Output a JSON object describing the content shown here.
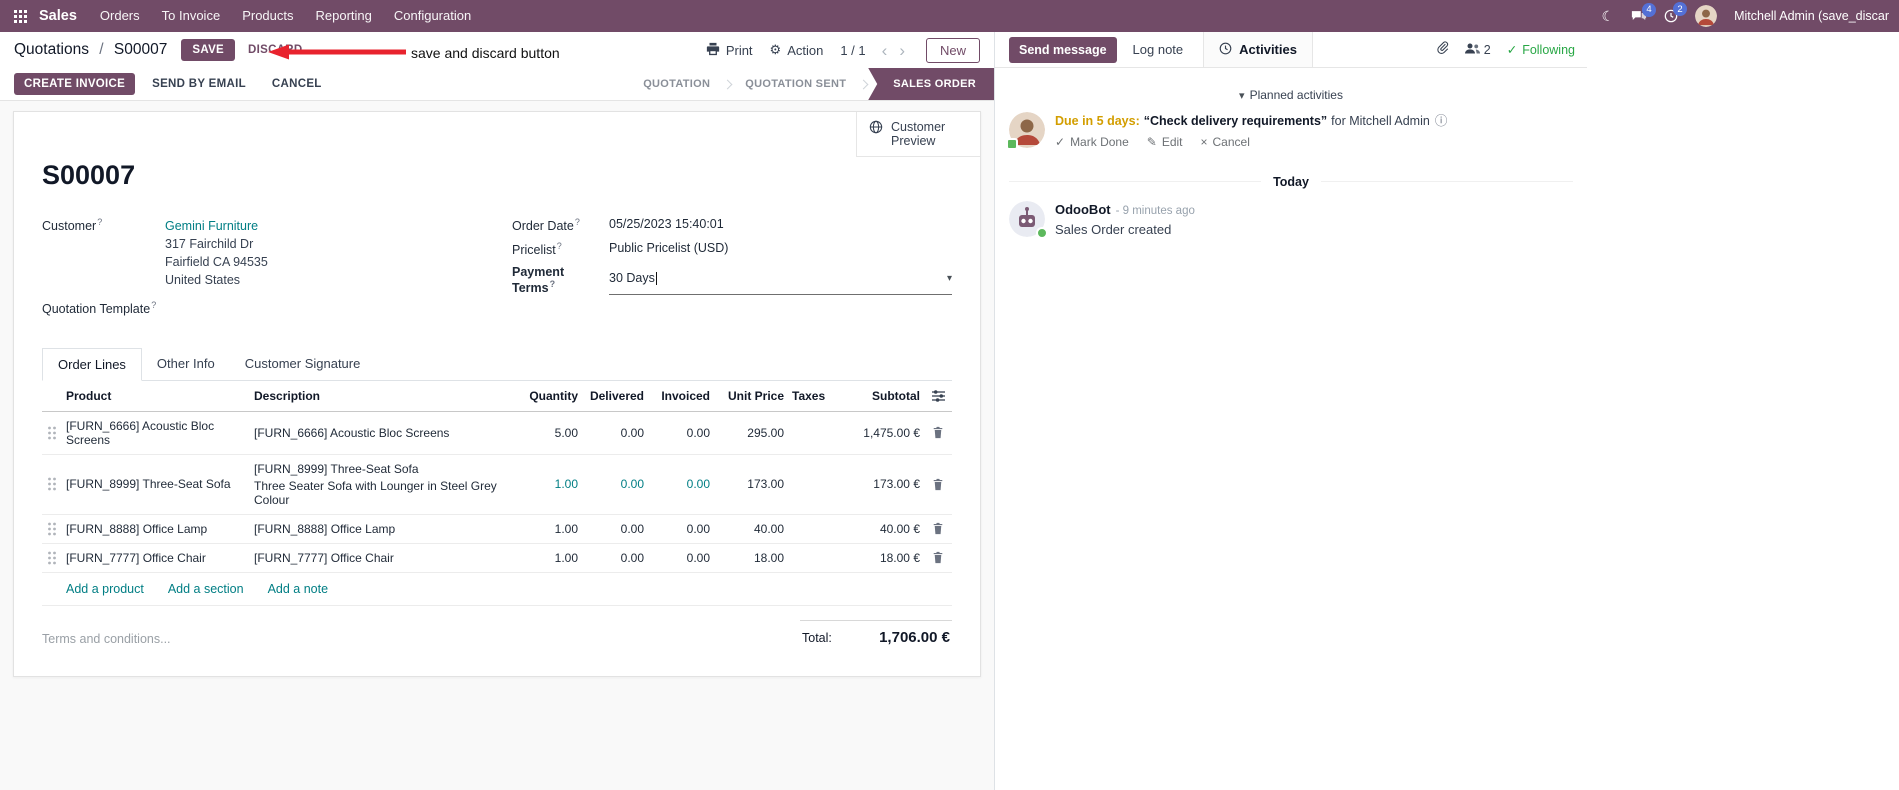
{
  "colors": {
    "brand": "#714B67",
    "link": "#017E84",
    "success": "#28a745",
    "warning": "#d39e00",
    "badge": "#5470d6",
    "annotation_red": "#e8232e"
  },
  "icons": {
    "caret_down": "▾",
    "gear": "⚙",
    "moon": "☾",
    "check": "✓",
    "pencil": "✎",
    "close": "×",
    "info": "ⓘ",
    "chev_left": "‹",
    "chev_right": "›",
    "help": "?",
    "slash": "/"
  },
  "topbar": {
    "app_name": "Sales",
    "menus": [
      "Orders",
      "To Invoice",
      "Products",
      "Reporting",
      "Configuration"
    ],
    "message_badge": "4",
    "activity_badge": "2",
    "user_name": "Mitchell Admin (save_discar"
  },
  "control_panel": {
    "breadcrumb_parent": "Quotations",
    "breadcrumb_current": "S00007",
    "save": "SAVE",
    "discard": "DISCARD",
    "print": "Print",
    "action": "Action",
    "pager": "1 / 1",
    "new": "New"
  },
  "annotation": {
    "label": "save and discard button"
  },
  "statusbar": {
    "create_invoice": "CREATE INVOICE",
    "send_by_email": "SEND BY EMAIL",
    "cancel": "CANCEL",
    "stages": [
      "QUOTATION",
      "QUOTATION SENT",
      "SALES ORDER"
    ]
  },
  "form": {
    "customer_preview": "Customer Preview",
    "title": "S00007",
    "customer_label": "Customer",
    "customer_name": "Gemini Furniture",
    "address": [
      "317 Fairchild Dr",
      "Fairfield CA 94535",
      "United States"
    ],
    "quotation_template_label": "Quotation Template",
    "order_date_label": "Order Date",
    "order_date": "05/25/2023 15:40:01",
    "pricelist_label": "Pricelist",
    "pricelist": "Public Pricelist (USD)",
    "payment_terms_label": "Payment Terms",
    "payment_terms": "30 Days",
    "tabs": [
      "Order Lines",
      "Other Info",
      "Customer Signature"
    ],
    "order_lines": {
      "headers": [
        "Product",
        "Description",
        "Quantity",
        "Delivered",
        "Invoiced",
        "Unit Price",
        "Taxes",
        "Subtotal"
      ],
      "rows": [
        {
          "product": "[FURN_6666] Acoustic Bloc Screens",
          "description": "[FURN_6666] Acoustic Bloc Screens",
          "description2": "",
          "quantity": "5.00",
          "delivered": "0.00",
          "invoiced": "0.00",
          "unit_price": "295.00",
          "taxes": "",
          "subtotal": "1,475.00 €"
        },
        {
          "product": "[FURN_8999] Three-Seat Sofa",
          "description": "[FURN_8999] Three-Seat Sofa",
          "description2": "Three Seater Sofa with Lounger in Steel Grey Colour",
          "quantity": "1.00",
          "delivered": "0.00",
          "invoiced": "0.00",
          "unit_price": "173.00",
          "taxes": "",
          "subtotal": "173.00 €"
        },
        {
          "product": "[FURN_8888] Office Lamp",
          "description": "[FURN_8888] Office Lamp",
          "description2": "",
          "quantity": "1.00",
          "delivered": "0.00",
          "invoiced": "0.00",
          "unit_price": "40.00",
          "taxes": "",
          "subtotal": "40.00 €"
        },
        {
          "product": "[FURN_7777] Office Chair",
          "description": "[FURN_7777] Office Chair",
          "description2": "",
          "quantity": "1.00",
          "delivered": "0.00",
          "invoiced": "0.00",
          "unit_price": "18.00",
          "taxes": "",
          "subtotal": "18.00 €"
        }
      ],
      "add_product": "Add a product",
      "add_section": "Add a section",
      "add_note": "Add a note",
      "terms_placeholder": "Terms and conditions...",
      "total_label": "Total:",
      "total_value": "1,706.00 €"
    }
  },
  "chatter": {
    "send_message": "Send message",
    "log_note": "Log note",
    "activities": "Activities",
    "followers_count": "2",
    "following": "Following",
    "planned_header": "Planned activities",
    "activity": {
      "due": "Due in 5 days:",
      "summary": "“Check delivery requirements”",
      "assignee": "for Mitchell Admin",
      "mark_done": "Mark Done",
      "edit": "Edit",
      "cancel": "Cancel"
    },
    "today": "Today",
    "message": {
      "author": "OdooBot",
      "time": "- 9 minutes ago",
      "body": "Sales Order created"
    }
  }
}
